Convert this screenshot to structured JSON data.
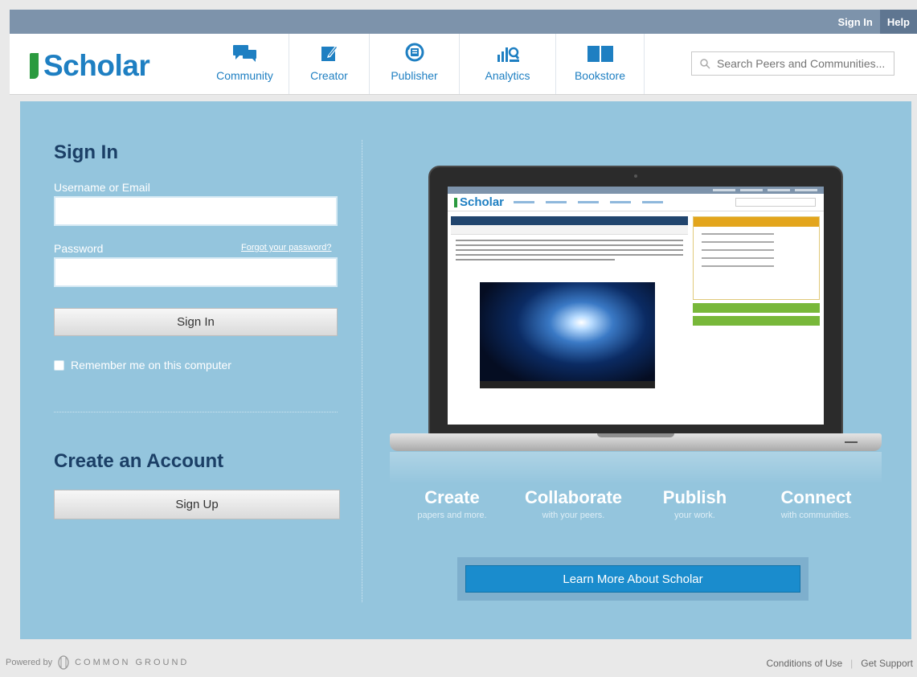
{
  "topbar": {
    "signin": "Sign In",
    "help": "Help"
  },
  "header": {
    "logo": "Scholar",
    "nav": [
      {
        "label": "Community",
        "icon": "chat-bubbles-icon"
      },
      {
        "label": "Creator",
        "icon": "pencil-icon"
      },
      {
        "label": "Publisher",
        "icon": "publish-cycle-icon"
      },
      {
        "label": "Analytics",
        "icon": "bar-chart-icon"
      },
      {
        "label": "Bookstore",
        "icon": "open-book-icon"
      }
    ],
    "search_placeholder": "Search Peers and Communities..."
  },
  "signin": {
    "title": "Sign In",
    "username_label": "Username or Email",
    "password_label": "Password",
    "forgot": "Forgot your password?",
    "button": "Sign In",
    "remember": "Remember me on this computer"
  },
  "create": {
    "title": "Create an Account",
    "button": "Sign Up"
  },
  "features": [
    {
      "title": "Create",
      "sub": "papers and more."
    },
    {
      "title": "Collaborate",
      "sub": "with your peers."
    },
    {
      "title": "Publish",
      "sub": "your work."
    },
    {
      "title": "Connect",
      "sub": "with communities."
    }
  ],
  "learn_more": "Learn More About Scholar",
  "footer": {
    "powered_by": "Powered by",
    "brand": "COMMON GROUND",
    "conditions": "Conditions of Use",
    "support": "Get Support"
  },
  "colors": {
    "brand_blue": "#1e7fc2",
    "panel": "#94c5dd",
    "topbar": "#7d93ab",
    "accent_green": "#2b9a3f"
  }
}
